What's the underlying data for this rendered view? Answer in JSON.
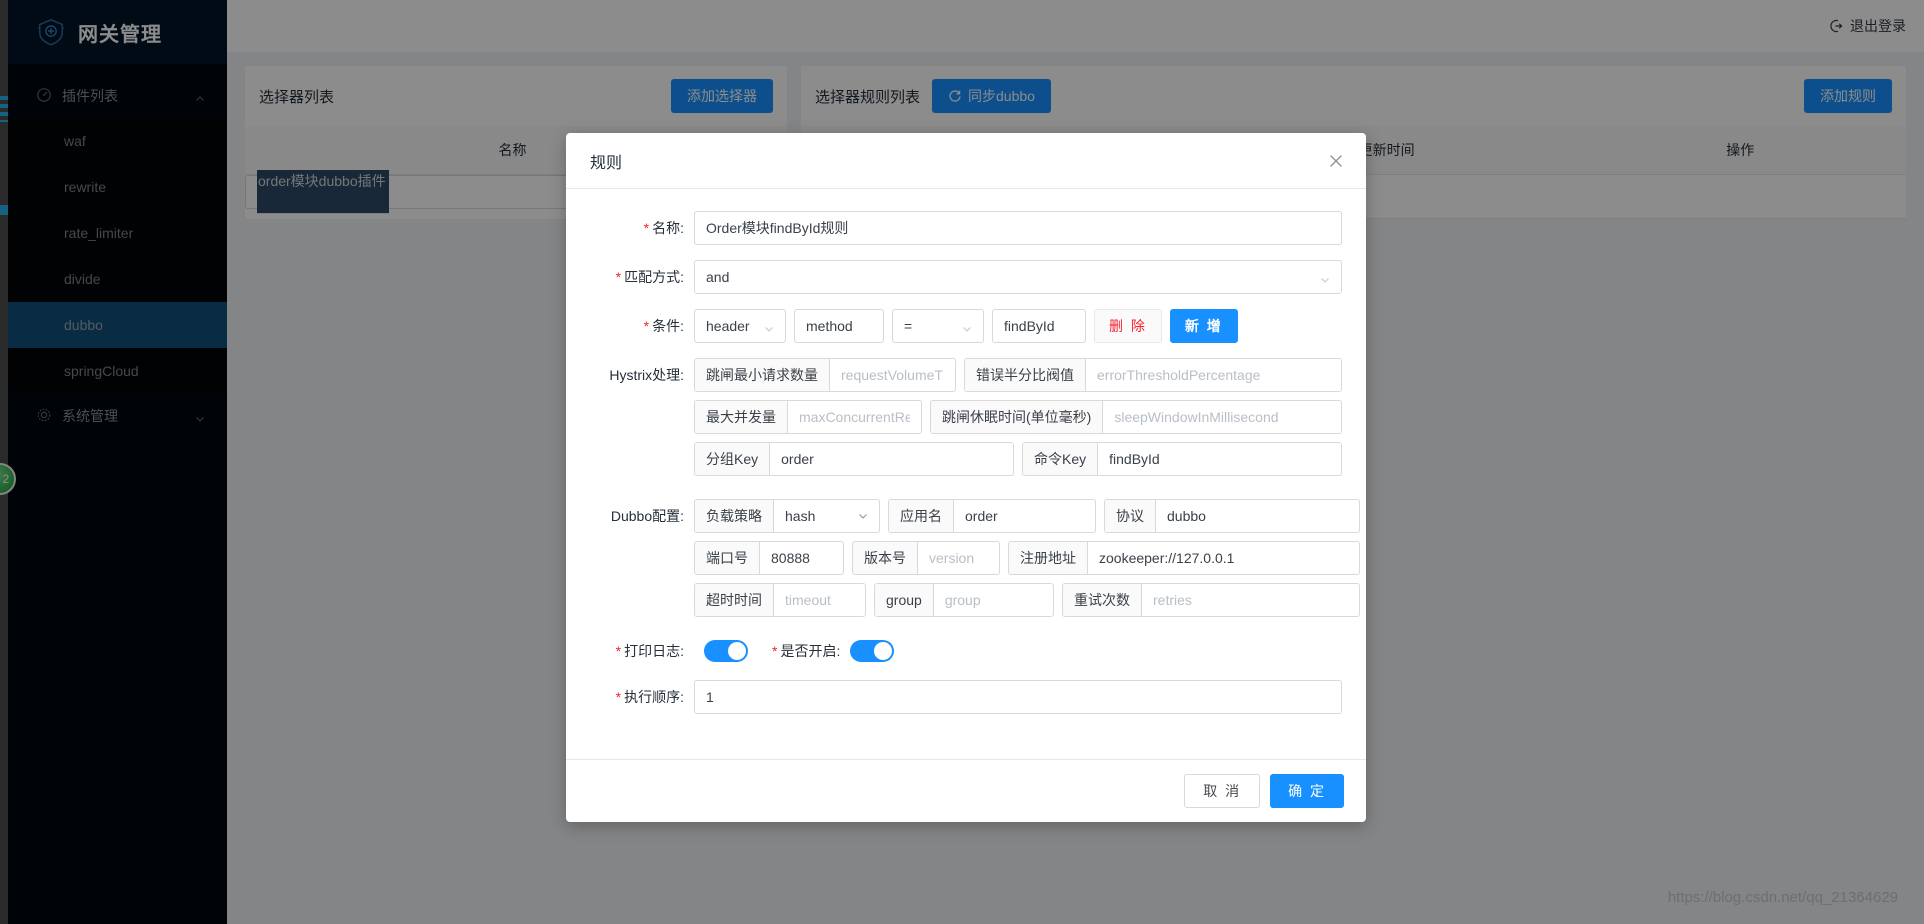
{
  "sidebar": {
    "logo_text": "网关管理",
    "logo_icon": "shield-gateway-icon",
    "groups": [
      {
        "label": "插件列表",
        "icon": "dashboard-icon",
        "caret": "chevron-up-icon",
        "expanded": true,
        "items": [
          {
            "label": "waf",
            "active": false
          },
          {
            "label": "rewrite",
            "active": false
          },
          {
            "label": "rate_limiter",
            "active": false
          },
          {
            "label": "divide",
            "active": false
          },
          {
            "label": "dubbo",
            "active": true
          },
          {
            "label": "springCloud",
            "active": false
          }
        ]
      },
      {
        "label": "系统管理",
        "icon": "gear-icon",
        "caret": "chevron-down-icon",
        "expanded": false,
        "items": []
      }
    ],
    "badge": "2"
  },
  "topbar": {
    "logout_label": "退出登录",
    "logout_icon": "logout-arrow-icon"
  },
  "selector_pane": {
    "title": "选择器列表",
    "add_button": "添加选择器",
    "columns": [
      "名称"
    ],
    "rows": [
      {
        "name": "order模块dubbo插件",
        "selected": true
      }
    ]
  },
  "rule_pane": {
    "title": "选择器规则列表",
    "sync_button": "同步dubbo",
    "sync_icon": "refresh-icon",
    "add_button": "添加规则",
    "columns": [
      "更新时间",
      "操作"
    ]
  },
  "modal": {
    "title": "规则",
    "close_icon": "close-icon",
    "name": {
      "label": "名称:",
      "required": true,
      "value": "Order模块findById规则"
    },
    "match_mode": {
      "label": "匹配方式:",
      "required": true,
      "value": "and",
      "chevron": "chevron-down-icon"
    },
    "condition": {
      "label": "条件:",
      "required": true,
      "field_type": "header",
      "field_name": "method",
      "operator": "=",
      "field_value": "findById",
      "delete_button": "删 除",
      "add_button": "新 增"
    },
    "hystrix": {
      "label": "Hystrix处理:",
      "fields": [
        {
          "addon": "跳闸最小请求数量",
          "placeholder": "requestVolumeThreshold",
          "value": ""
        },
        {
          "addon": "错误半分比阀值",
          "placeholder": "errorThresholdPercentage",
          "value": ""
        },
        {
          "addon": "最大并发量",
          "placeholder": "maxConcurrentRequests",
          "value": ""
        },
        {
          "addon": "跳闸休眠时间(单位毫秒)",
          "placeholder": "sleepWindowInMillisecond",
          "value": ""
        },
        {
          "addon": "分组Key",
          "placeholder": "",
          "value": "order"
        },
        {
          "addon": "命令Key",
          "placeholder": "",
          "value": "findById"
        }
      ]
    },
    "dubbo": {
      "label": "Dubbo配置:",
      "load_strategy": {
        "addon": "负载策略",
        "value": "hash",
        "chevron": "chevron-down-icon"
      },
      "fields": [
        {
          "addon": "应用名",
          "placeholder": "",
          "value": "order"
        },
        {
          "addon": "协议",
          "placeholder": "",
          "value": "dubbo"
        },
        {
          "addon": "端口号",
          "placeholder": "",
          "value": "80888"
        },
        {
          "addon": "版本号",
          "placeholder": "version",
          "value": ""
        },
        {
          "addon": "注册地址",
          "placeholder": "",
          "value": "zookeeper://127.0.0.1"
        },
        {
          "addon": "超时时间",
          "placeholder": "timeout",
          "value": ""
        },
        {
          "addon": "group",
          "placeholder": "group",
          "value": ""
        },
        {
          "addon": "重试次数",
          "placeholder": "retries",
          "value": ""
        }
      ]
    },
    "print_log": {
      "label": "打印日志:",
      "required": true,
      "on": true
    },
    "enabled": {
      "label": "是否开启:",
      "required": true,
      "on": true
    },
    "order": {
      "label": "执行顺序:",
      "required": true,
      "value": "1"
    },
    "cancel_button": "取 消",
    "confirm_button": "确 定"
  },
  "watermark": "https://blog.csdn.net/qq_21364629",
  "colors": {
    "accent": "#1890ff",
    "sidebar_bg": "#00060f",
    "sidebar_active": "#12507d",
    "danger": "#f5222d"
  }
}
